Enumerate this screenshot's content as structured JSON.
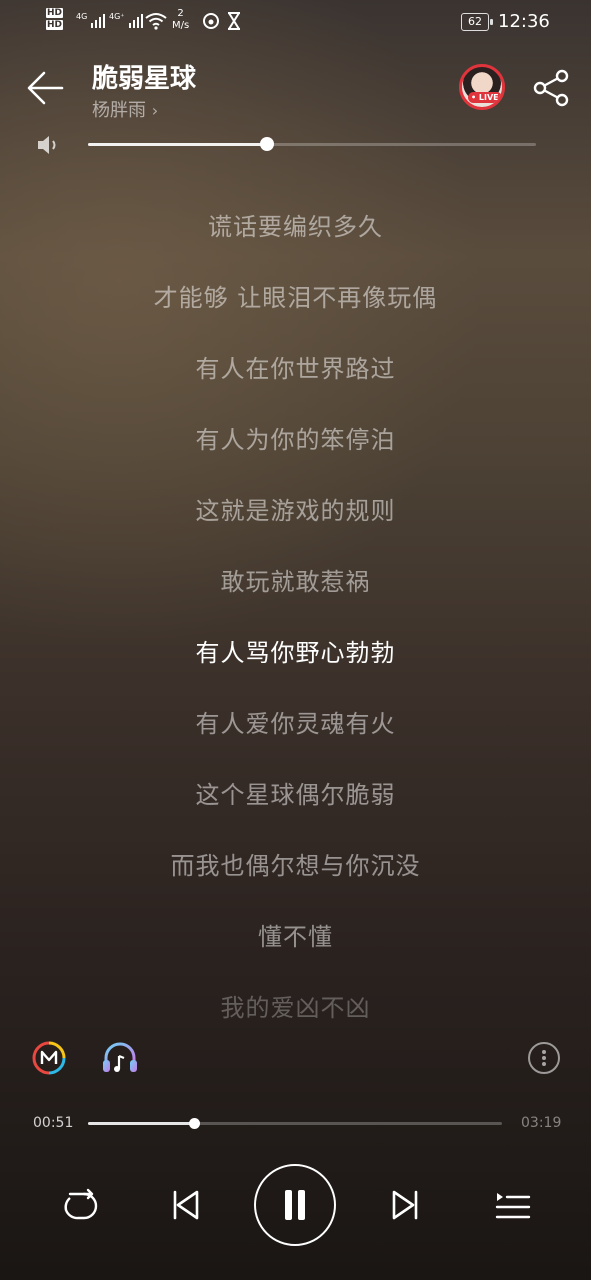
{
  "status_bar": {
    "hd1": "HD",
    "hd2": "HD",
    "net1": "4G",
    "net2": "4G⁺",
    "speed_value": "2",
    "speed_unit": "M/s",
    "battery": "62",
    "time": "12:36"
  },
  "header": {
    "title": "脆弱星球",
    "artist": "杨胖雨",
    "live_badge": "LIVE"
  },
  "volume": {
    "level": 0.4
  },
  "lyrics": [
    "谎话要编织多久",
    "才能够 让眼泪不再像玩偶",
    "有人在你世界路过",
    "有人为你的笨停泊",
    "这就是游戏的规则",
    "敢玩就敢惹祸",
    "有人骂你野心勃勃",
    "有人爱你灵魂有火",
    "这个星球偶尔脆弱",
    "而我也偶尔想与你沉没",
    "懂不懂",
    "我的爱凶不凶"
  ],
  "active_lyric_index": 6,
  "playback": {
    "current_time": "00:51",
    "total_time": "03:19",
    "progress": 0.256
  },
  "icons": {
    "back": "arrow-left-icon",
    "share": "share-icon",
    "volume": "speaker-icon",
    "m_tool": "m-circle-icon",
    "headphones": "headphones-icon",
    "more": "more-vertical-icon",
    "repeat": "repeat-icon",
    "prev": "skip-previous-icon",
    "pause": "pause-icon",
    "next": "skip-next-icon",
    "playlist": "playlist-icon"
  }
}
